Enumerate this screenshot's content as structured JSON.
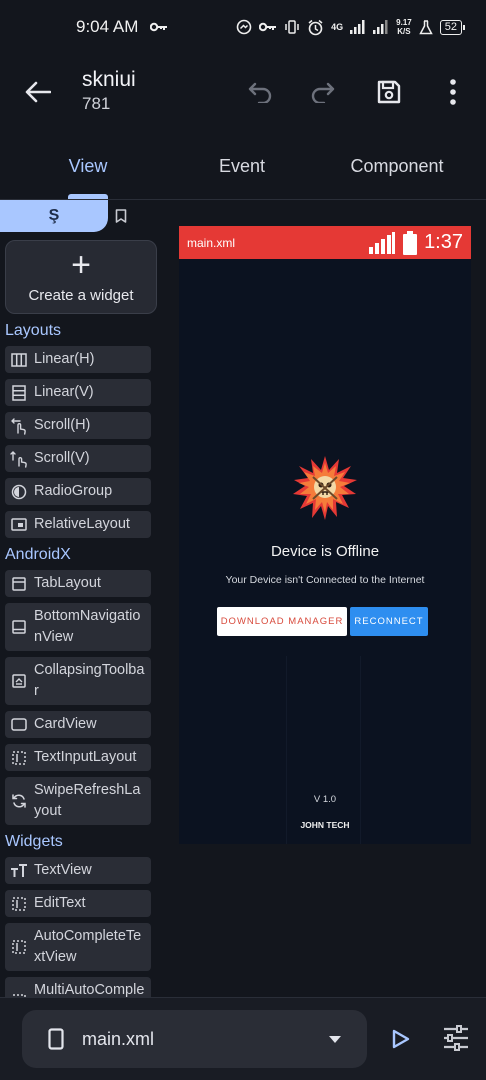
{
  "status_bar": {
    "time": "9:04 AM",
    "network": "4G",
    "speed_value": "9.17",
    "speed_unit": "K/S",
    "battery": "52"
  },
  "app_bar": {
    "title": "skniui",
    "subtitle": "781"
  },
  "tabs": [
    {
      "label": "View",
      "active": true
    },
    {
      "label": "Event",
      "active": false
    },
    {
      "label": "Component",
      "active": false
    }
  ],
  "palette": {
    "active_tab_glyph": "Ş",
    "create_label": "Create a widget",
    "sections": [
      {
        "title": "Layouts",
        "items": [
          {
            "label": "Linear(H)",
            "icon": "columns-icon"
          },
          {
            "label": "Linear(V)",
            "icon": "rows-icon"
          },
          {
            "label": "Scroll(H)",
            "icon": "swipe-horizontal-icon"
          },
          {
            "label": "Scroll(V)",
            "icon": "swipe-vertical-icon"
          },
          {
            "label": "RadioGroup",
            "icon": "radio-icon"
          },
          {
            "label": "RelativeLayout",
            "icon": "relative-layout-icon"
          }
        ]
      },
      {
        "title": "AndroidX",
        "items": [
          {
            "label": "TabLayout",
            "icon": "tab-layout-icon"
          },
          {
            "label": "BottomNavigationView",
            "icon": "bottom-nav-icon"
          },
          {
            "label": "CollapsingToolbar",
            "icon": "collapsing-toolbar-icon"
          },
          {
            "label": "CardView",
            "icon": "card-icon"
          },
          {
            "label": "TextInputLayout",
            "icon": "text-input-icon"
          },
          {
            "label": "SwipeRefreshLayout",
            "icon": "refresh-icon"
          }
        ]
      },
      {
        "title": "Widgets",
        "items": [
          {
            "label": "TextView",
            "icon": "text-icon"
          },
          {
            "label": "EditText",
            "icon": "edit-text-icon"
          },
          {
            "label": "AutoCompleteTextView",
            "icon": "autocomplete-icon"
          },
          {
            "label": "MultiAutoCompleteTextView",
            "icon": "multi-autocomplete-icon"
          }
        ]
      }
    ]
  },
  "preview": {
    "file": "main.xml",
    "time": "1:37",
    "title": "Device is Offline",
    "message": "Your Device isn't Connected to the Internet",
    "download_label": "DOWNLOAD MANAGER",
    "reconnect_label": "RECONNECT",
    "version": "V 1.0",
    "brand": "JOHN TECH",
    "colors": {
      "status": "#e53935",
      "background": "#0b1220",
      "reconnect": "#2e8ef0",
      "download_text": "#d84a3c"
    }
  },
  "bottom_bar": {
    "file": "main.xml"
  },
  "colors": {
    "accent": "#a9c7ff",
    "background": "#13161d"
  }
}
